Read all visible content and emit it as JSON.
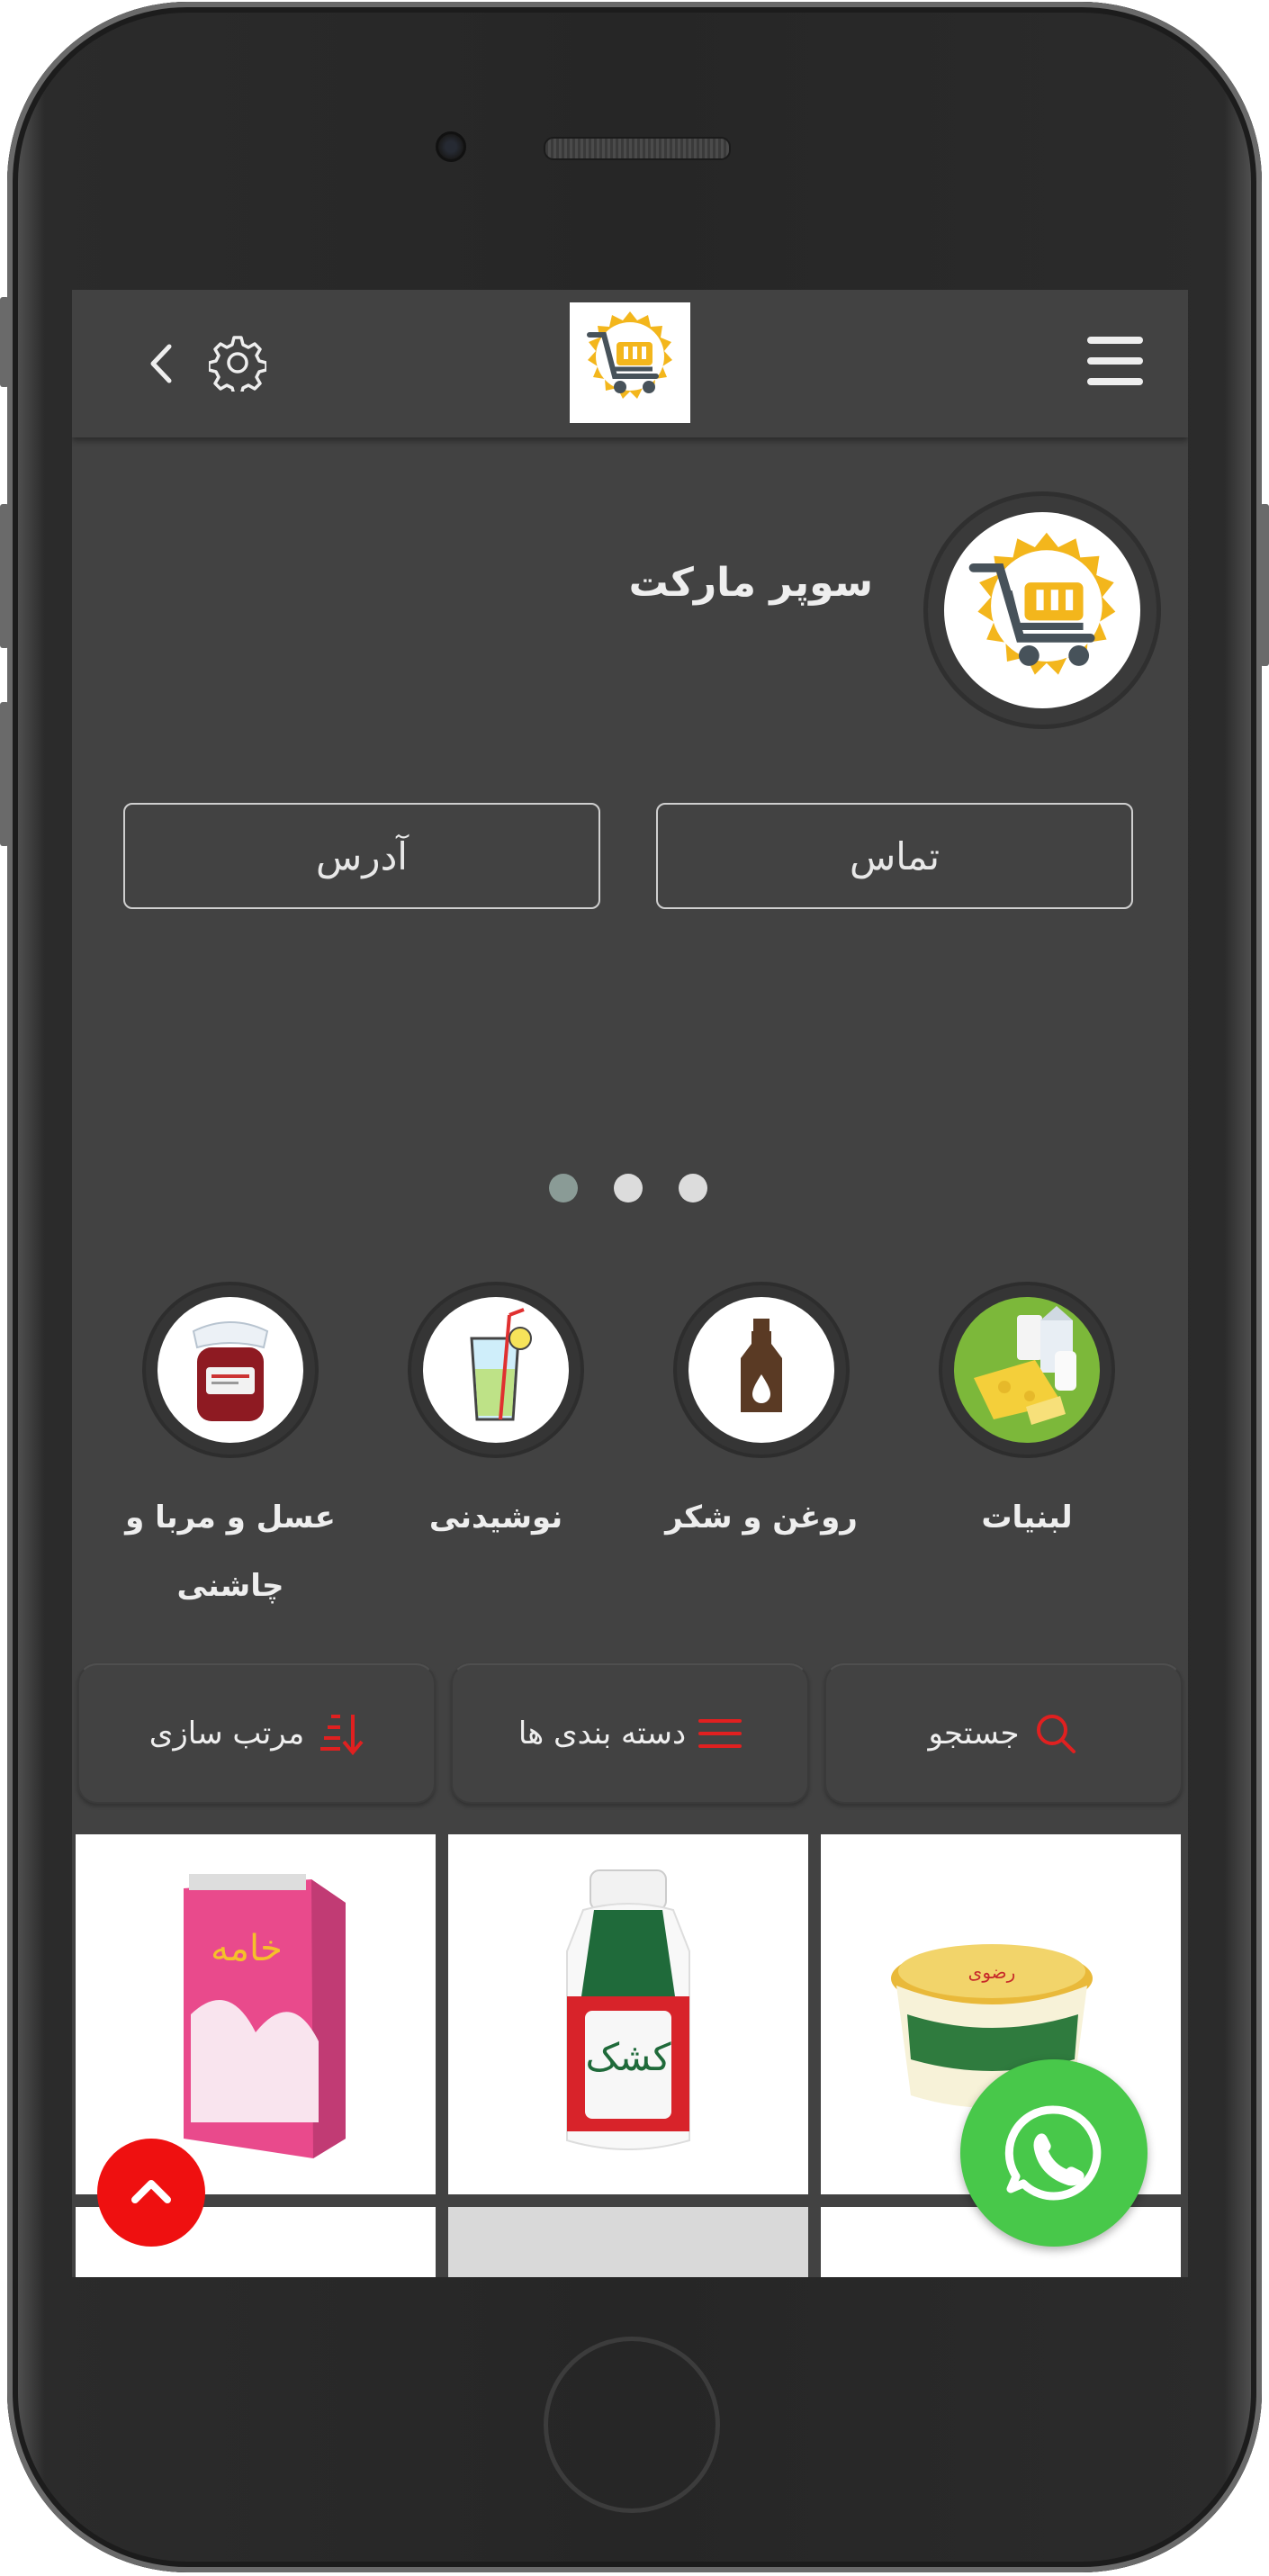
{
  "header": {
    "menu_icon": "hamburger-icon",
    "logo_icon": "shopping-cart-badge-icon",
    "settings_icon": "gear-icon",
    "back_icon": "chevron-left-icon"
  },
  "store": {
    "name": "سوپر مارکت",
    "logo_icon": "shopping-cart-badge-icon"
  },
  "actions": {
    "contact_label": "تماس",
    "address_label": "آدرس"
  },
  "slider": {
    "dot_count": 3,
    "active_dot": 3
  },
  "categories": [
    {
      "label": "لبنیات",
      "icon": "dairy-icon"
    },
    {
      "label": "روغن و شکر",
      "icon": "bottle-icon"
    },
    {
      "label": "نوشیدنی",
      "icon": "drink-glass-icon"
    },
    {
      "label": "عسل و مربا و چاشنی",
      "icon": "jam-jar-icon"
    }
  ],
  "toolbar": {
    "search_label": "جستجو",
    "categories_label": "دسته بندی ها",
    "sort_label": "مرتب سازی",
    "accent_color": "#e02020"
  },
  "products": [
    {
      "icon": "butter-tub-icon"
    },
    {
      "icon": "kashk-bottle-icon"
    },
    {
      "icon": "cream-carton-icon"
    }
  ],
  "floating": {
    "whatsapp_icon": "whatsapp-icon",
    "scroll_top_icon": "chevron-up-icon",
    "whatsapp_color": "#48c84a",
    "scroll_top_color": "#ef1010"
  }
}
